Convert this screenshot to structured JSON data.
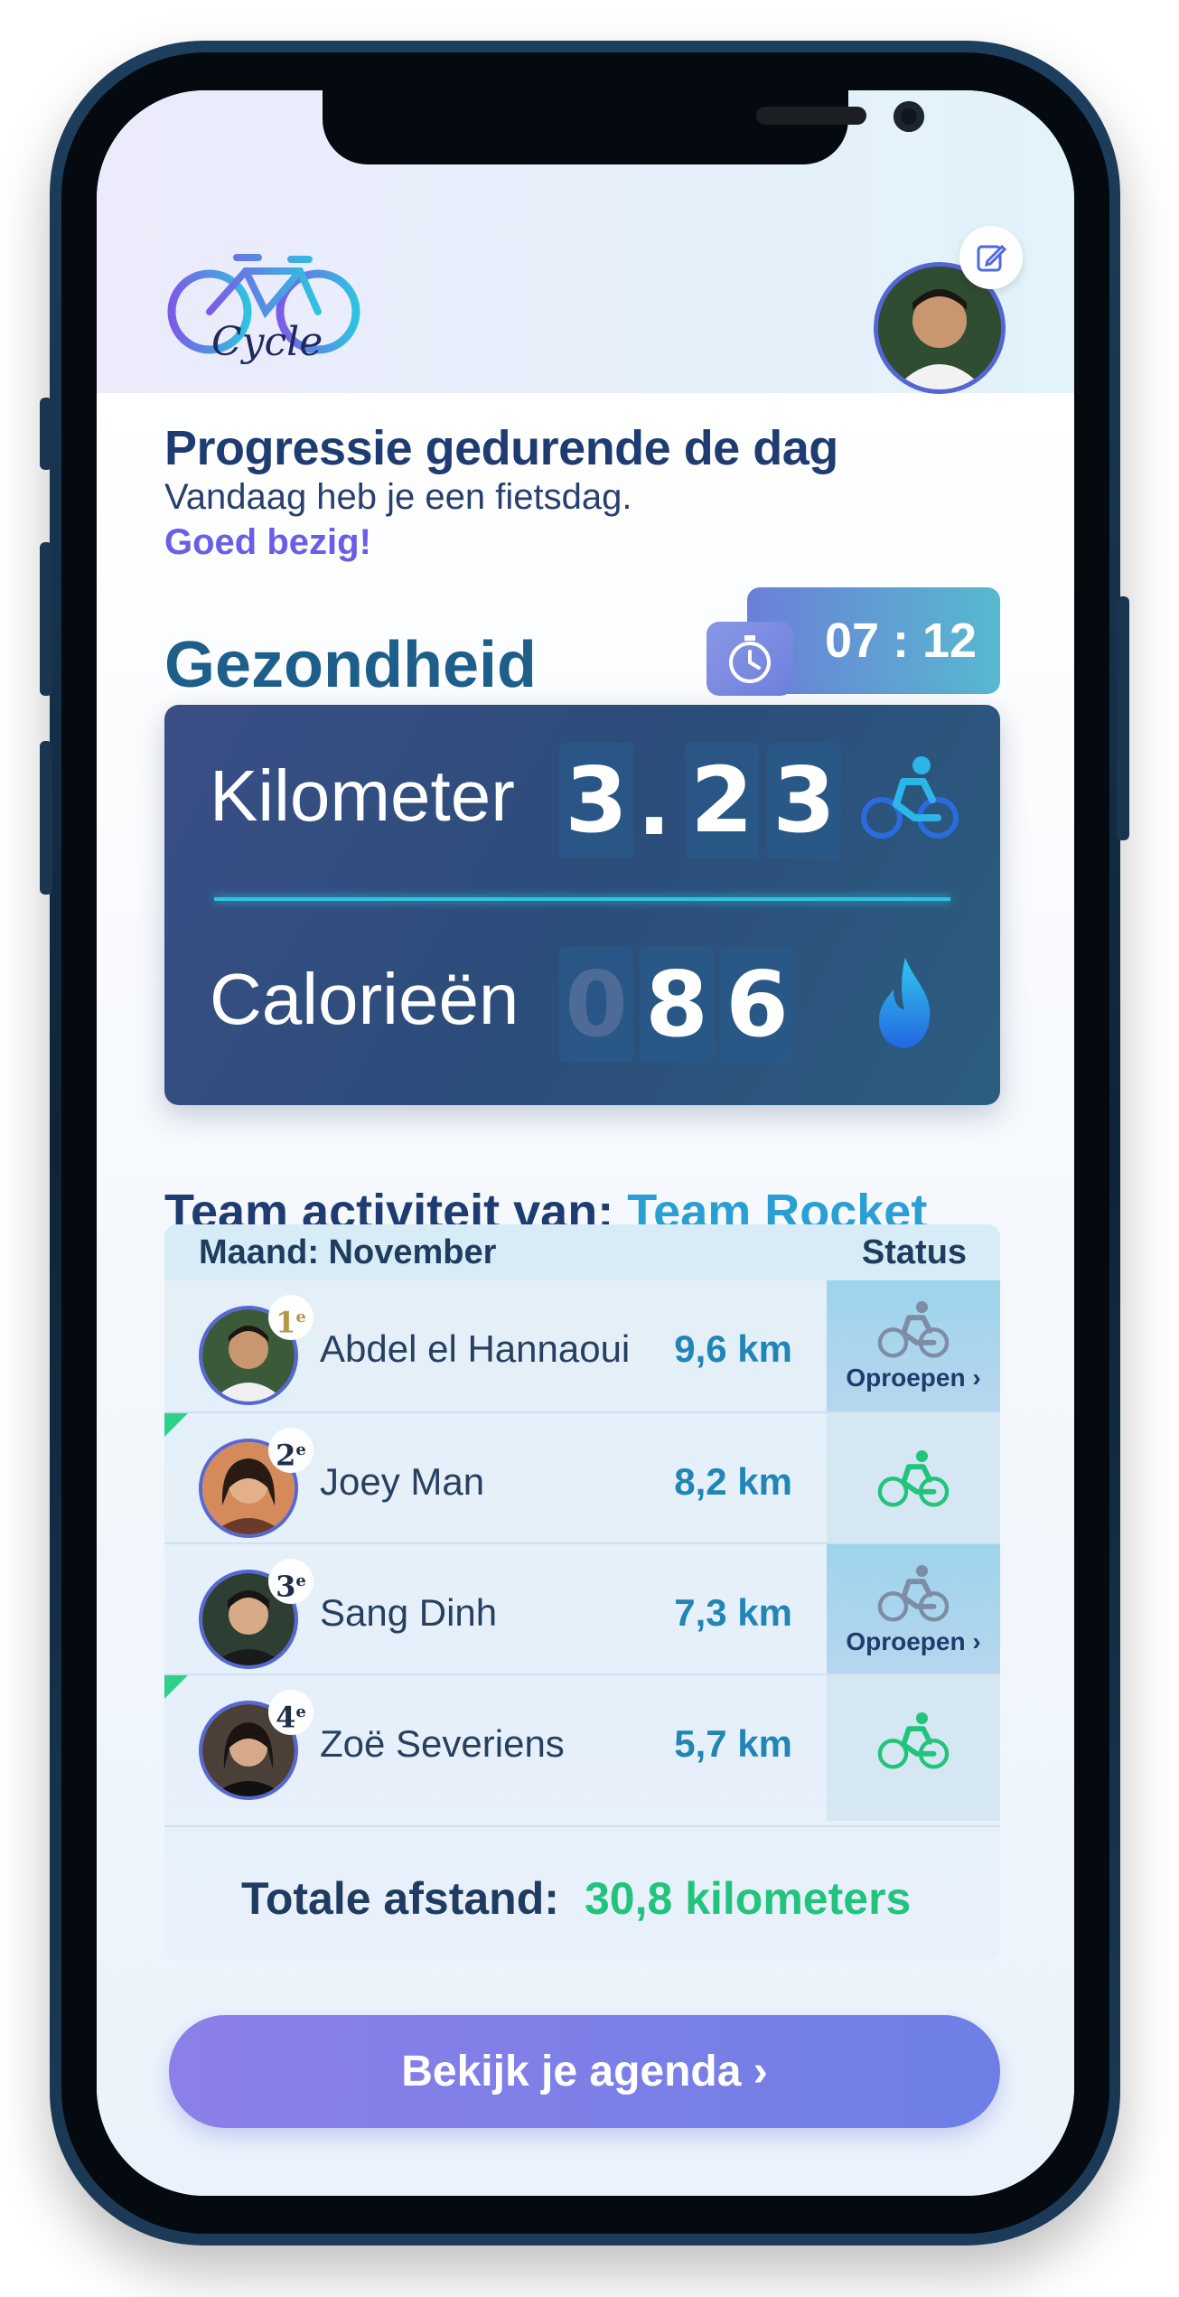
{
  "app": {
    "logo_text": "Cycle"
  },
  "progress": {
    "title": "Progressie gedurende de dag",
    "subtitle": "Vandaag heb je een fietsdag.",
    "praise": "Goed bezig!"
  },
  "health": {
    "title": "Gezondheid",
    "timer": "07 : 12",
    "kilometer_label": "Kilometer",
    "kilometer_digits": [
      "3",
      ".",
      "2",
      "3"
    ],
    "calories_label": "Calorieën",
    "calories_digits": [
      "0",
      "8",
      "6"
    ]
  },
  "team": {
    "title_prefix": "Team activiteit van:",
    "team_name": "Team Rocket",
    "month_header": "Maand: November",
    "status_header": "Status",
    "members": [
      {
        "rank": "1",
        "rank_suffix": "e",
        "name": "Abdel el Hannaoui",
        "distance": "9,6 km",
        "status": "Oproepen",
        "status_type": "call"
      },
      {
        "rank": "2",
        "rank_suffix": "e",
        "name": "Joey Man",
        "distance": "8,2 km",
        "status": "",
        "status_type": "active"
      },
      {
        "rank": "3",
        "rank_suffix": "e",
        "name": "Sang Dinh",
        "distance": "7,3 km",
        "status": "Oproepen",
        "status_type": "call"
      },
      {
        "rank": "4",
        "rank_suffix": "e",
        "name": "Zoë Severiens",
        "distance": "5,7 km",
        "status": "",
        "status_type": "active"
      }
    ],
    "total_label": "Totale afstand:",
    "total_value": "30,8 kilometers"
  },
  "agenda_button": "Bekijk je agenda",
  "colors": {
    "primary": "#1f3c72",
    "accent": "#6a5ee6",
    "teal": "#2a9fd4",
    "green": "#22c47d"
  }
}
